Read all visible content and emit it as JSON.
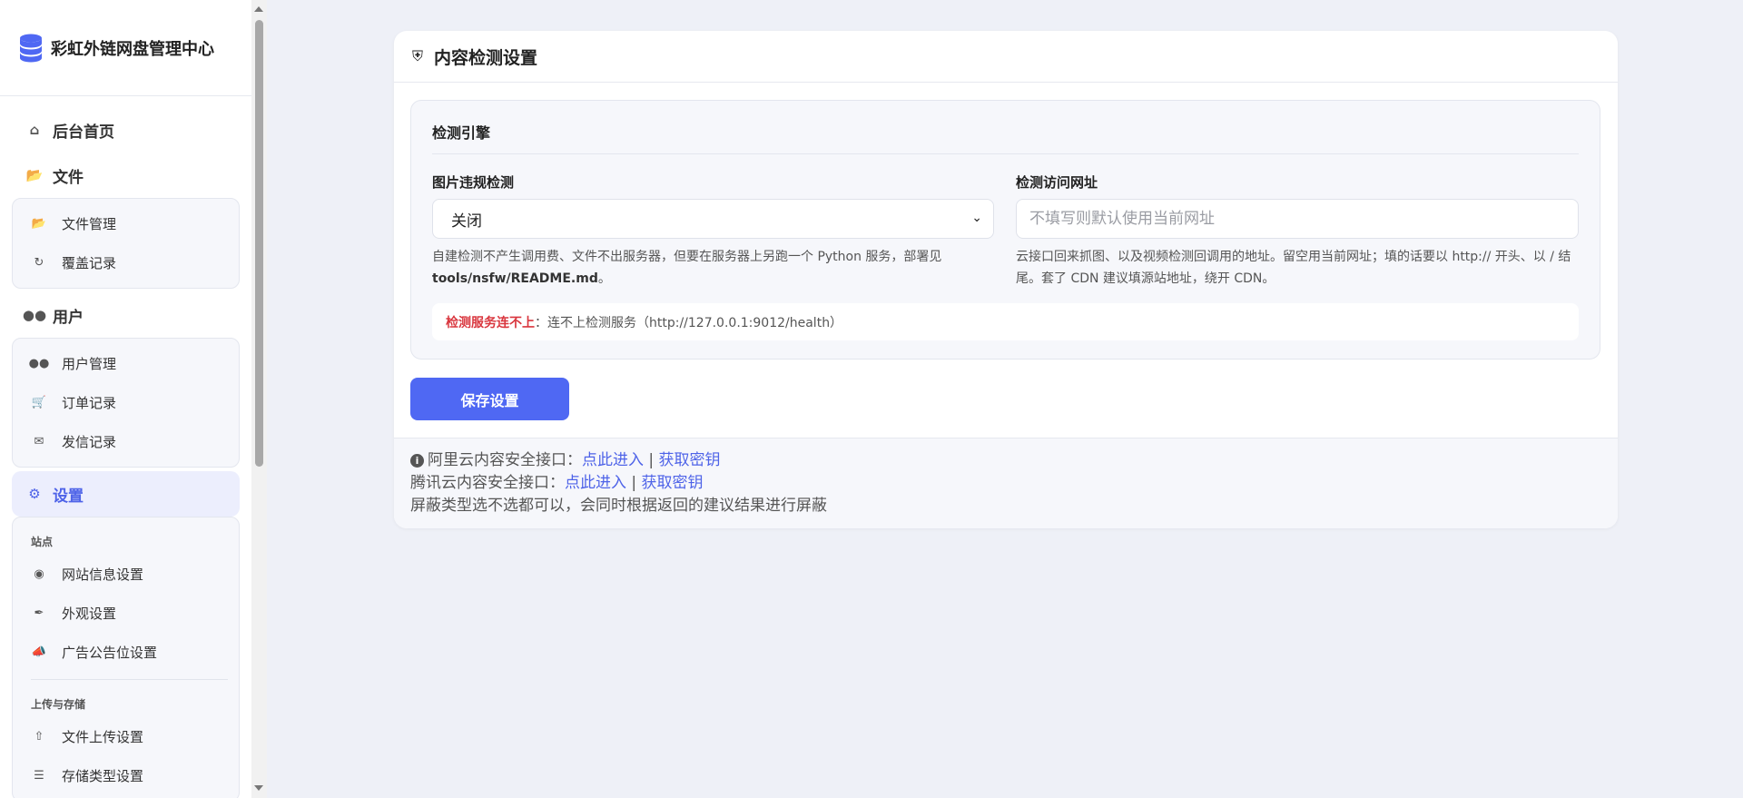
{
  "app": {
    "title": "彩虹外链网盘管理中心",
    "logo_icon": "database-icon"
  },
  "sidebar": {
    "home": {
      "label": "后台首页",
      "icon": "home-icon"
    },
    "files": {
      "label": "文件",
      "icon": "folder-open-icon",
      "items": [
        {
          "label": "文件管理",
          "icon": "folder-open-icon"
        },
        {
          "label": "覆盖记录",
          "icon": "refresh-icon"
        }
      ]
    },
    "users": {
      "label": "用户",
      "icon": "users-icon",
      "items": [
        {
          "label": "用户管理",
          "icon": "users-icon"
        },
        {
          "label": "订单记录",
          "icon": "cart-icon"
        },
        {
          "label": "发信记录",
          "icon": "envelope-icon"
        }
      ]
    },
    "settings": {
      "label": "设置",
      "icon": "gear-icon",
      "active": true,
      "sections": [
        {
          "title": "站点",
          "items": [
            {
              "label": "网站信息设置",
              "icon": "globe-icon"
            },
            {
              "label": "外观设置",
              "icon": "brush-icon"
            },
            {
              "label": "广告公告位设置",
              "icon": "bullhorn-icon"
            }
          ]
        },
        {
          "title": "上传与存储",
          "items": [
            {
              "label": "文件上传设置",
              "icon": "upload-icon"
            },
            {
              "label": "存储类型设置",
              "icon": "database-icon"
            }
          ]
        }
      ]
    }
  },
  "card": {
    "title": "内容检测设置",
    "icon": "shield-icon",
    "engine": {
      "title": "检测引擎",
      "image_check": {
        "label": "图片违规检测",
        "value": "关闭",
        "help_prefix": "自建检测不产生调用费、文件不出服务器，但要在服务器上另跑一个 Python 服务，部署见",
        "help_path": "tools/nsfw/README.md",
        "help_suffix": "。"
      },
      "callback_url": {
        "label": "检测访问网址",
        "placeholder": "不填写则默认使用当前网址",
        "help": "云接口回来抓图、以及视频检测回调用的地址。留空用当前网址；填的话要以 http:// 开头、以 / 结尾。套了 CDN 建议填源站地址，绕开 CDN。"
      },
      "status": {
        "error_label": "检测服务连不上",
        "message": "：连不上检测服务（http://127.0.0.1:9012/health）"
      }
    },
    "save_label": "保存设置",
    "footer": {
      "aliyun_label": "阿里云内容安全接口：",
      "aliyun_enter": "点此进入",
      "aliyun_key": "获取密钥",
      "tencent_label": "腾讯云内容安全接口：",
      "tencent_enter": "点此进入",
      "tencent_key": "获取密钥",
      "separator": "|",
      "note": "屏蔽类型选不选都可以，会同时根据返回的建议结果进行屏蔽"
    }
  },
  "colors": {
    "accent": "#4f68f3",
    "error": "#d9363e",
    "background": "#eef0f7"
  }
}
